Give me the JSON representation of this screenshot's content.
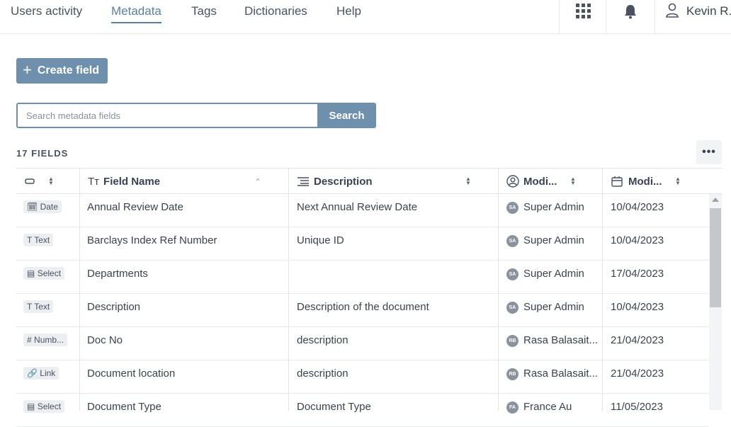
{
  "nav": {
    "items": [
      {
        "label": "Users activity",
        "active": false
      },
      {
        "label": "Metadata",
        "active": true
      },
      {
        "label": "Tags",
        "active": false
      },
      {
        "label": "Dictionaries",
        "active": false
      },
      {
        "label": "Help",
        "active": false
      }
    ],
    "user_name": "Kevin R.",
    "accent": "#5a7f9f"
  },
  "actions": {
    "create_label": "Create field",
    "search_placeholder": "Search metadata fields",
    "search_value": "",
    "search_label": "Search",
    "button_color": "#6f90ad"
  },
  "fields_count": "17 FIELDS",
  "more_label": "•••",
  "table": {
    "columns": [
      {
        "label": "",
        "icon": "type-icon"
      },
      {
        "label": "Field Name",
        "icon": "text-type-icon"
      },
      {
        "label": "Description",
        "icon": "align-left-icon"
      },
      {
        "label": "Modi...",
        "icon": "user-circle-icon"
      },
      {
        "label": "Modi...",
        "icon": "calendar-icon"
      }
    ],
    "rows": [
      {
        "type_icon": "🗓",
        "type": "Date",
        "name": "Annual Review Date",
        "description": "Next Annual Review Date",
        "avatar": "SA",
        "modified_by": "Super Admin",
        "modified_on": "10/04/2023"
      },
      {
        "type_icon": "T",
        "type": "Text",
        "name": "Barclays Index Ref Number",
        "description": "Unique ID",
        "avatar": "SA",
        "modified_by": "Super Admin",
        "modified_on": "10/04/2023"
      },
      {
        "type_icon": "▤",
        "type": "Select",
        "name": "Departments",
        "description": "",
        "avatar": "SA",
        "modified_by": "Super Admin",
        "modified_on": "17/04/2023"
      },
      {
        "type_icon": "T",
        "type": "Text",
        "name": "Description",
        "description": "Description of the document",
        "avatar": "SA",
        "modified_by": "Super Admin",
        "modified_on": "10/04/2023"
      },
      {
        "type_icon": "#",
        "type": "Numb...",
        "name": "Doc No",
        "description": "description",
        "avatar": "RB",
        "modified_by": "Rasa Balasait...",
        "modified_on": "21/04/2023"
      },
      {
        "type_icon": "🔗",
        "type": "Link",
        "name": "Document location",
        "description": "description",
        "avatar": "RB",
        "modified_by": "Rasa Balasait...",
        "modified_on": "21/04/2023"
      },
      {
        "type_icon": "▤",
        "type": "Select",
        "name": "Document Type",
        "description": "Document Type",
        "avatar": "FA",
        "modified_by": "France Au",
        "modified_on": "11/05/2023"
      }
    ]
  }
}
